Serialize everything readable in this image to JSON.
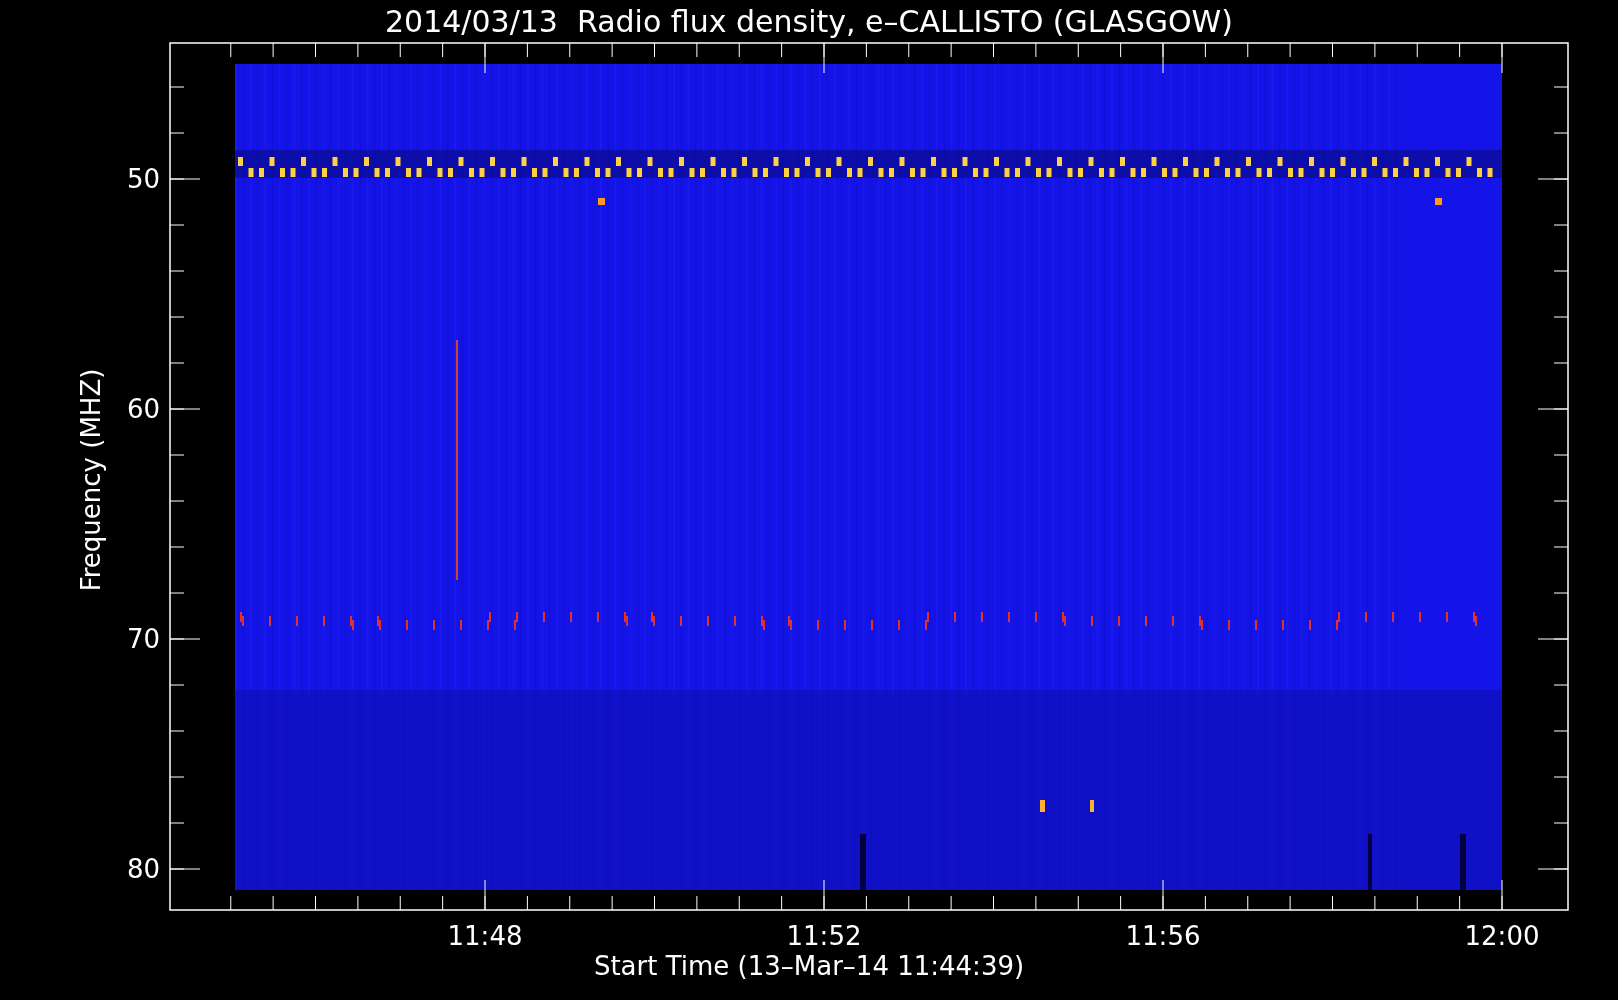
{
  "title": "2014/03/13  Radio flux density, e–CALLISTO (GLASGOW)",
  "y_axis": {
    "label": "Frequency (MHZ)",
    "ticks": [
      "50",
      "60",
      "70",
      "80"
    ]
  },
  "x_axis": {
    "label": "Start Time (13–Mar–14 11:44:39)",
    "ticks": [
      "11:48",
      "11:52",
      "11:56",
      "12:00"
    ]
  }
}
